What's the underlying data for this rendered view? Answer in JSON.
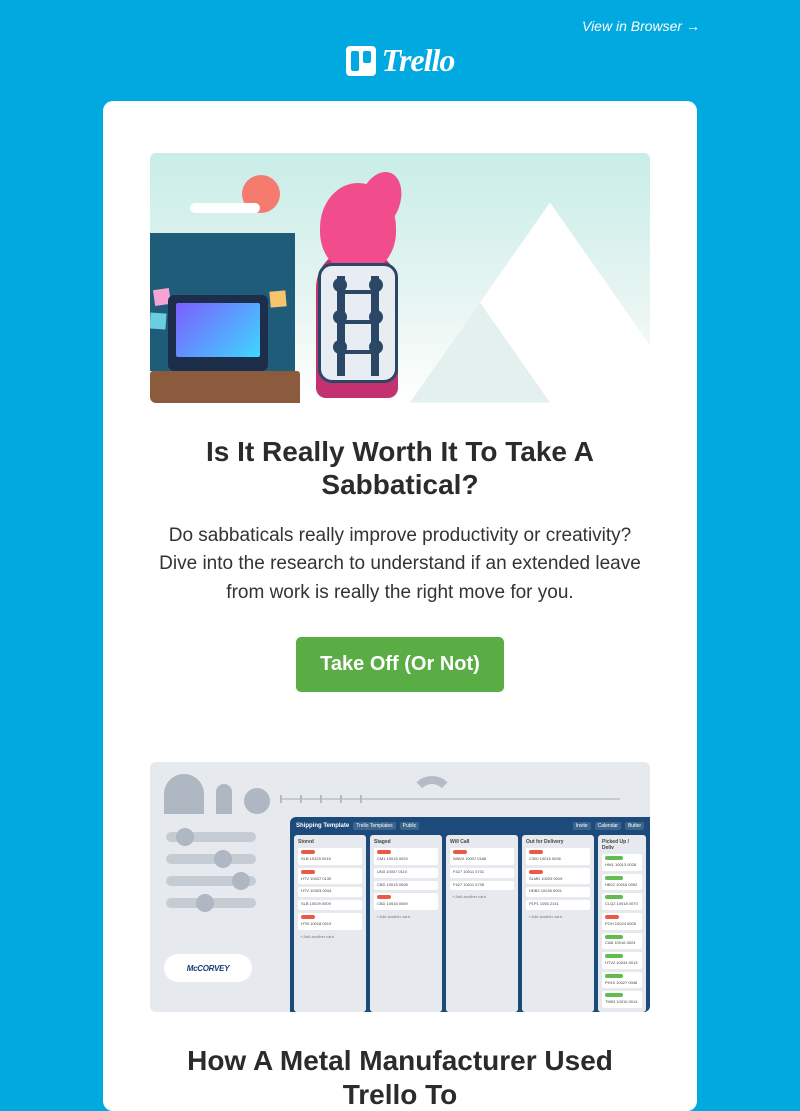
{
  "header": {
    "view_in_browser": "View in Browser →",
    "brand": "Trello"
  },
  "article1": {
    "title": "Is It Really Worth It To Take A Sabbatical?",
    "body": "Do sabbaticals really improve productivity or creativity? Dive into the research to understand if an extended leave from work is really the right move for you.",
    "cta": "Take Off (Or Not)"
  },
  "article2": {
    "title": "How A Metal Manufacturer Used Trello To",
    "logo": "McCORVEY",
    "board": {
      "name": "Shipping Template",
      "chips": [
        "Trello Templates",
        "Public",
        "Invite",
        "Calendar",
        "Butler"
      ],
      "lists": [
        {
          "name": "Stored",
          "cards": [
            {
              "label": "red",
              "text": "SLB 10329 0015"
            },
            {
              "label": "red",
              "text": "HTV 10437 0130"
            },
            {
              "text": "HTV 10303 0044"
            },
            {
              "text": "SLB 10029 0009"
            },
            {
              "label": "red",
              "text": "HTB 10018 0019"
            }
          ]
        },
        {
          "name": "Staged",
          "cards": [
            {
              "label": "red",
              "text": "CM1 10015 0029"
            },
            {
              "text": "UN3 10007 0110"
            },
            {
              "text": "CBD 10015 0008"
            },
            {
              "label": "red",
              "text": "CBD 10016 0069"
            }
          ]
        },
        {
          "name": "Will Call",
          "cards": [
            {
              "label": "red",
              "text": "WAV9 10007 0186"
            },
            {
              "text": "F427 10011 0731"
            },
            {
              "text": "F427 10011 0739"
            }
          ]
        },
        {
          "name": "Out for Delivery",
          "cards": [
            {
              "label": "red",
              "text": "C300 10016 0036"
            },
            {
              "label": "red",
              "text": "SLMD 10029 0019"
            },
            {
              "text": "HDB2 10245 0001"
            },
            {
              "text": "P1P1 1050 2141"
            }
          ]
        },
        {
          "name": "Picked Up / Deliv",
          "cards": [
            {
              "label": "green",
              "text": "HW1 10013 0028"
            },
            {
              "label": "green",
              "text": "HB22 10016 0092"
            },
            {
              "label": "green",
              "text": "CLQ2 10018 0070"
            },
            {
              "label": "red",
              "text": "PGH 10024 0005"
            },
            {
              "label": "green",
              "text": "CAB 10016 0024"
            },
            {
              "label": "green",
              "text": "HTV2 10044 0013"
            },
            {
              "label": "green",
              "text": "PH15 10027 0046"
            },
            {
              "label": "green",
              "text": "THB3 10010 0014"
            }
          ]
        }
      ]
    }
  }
}
